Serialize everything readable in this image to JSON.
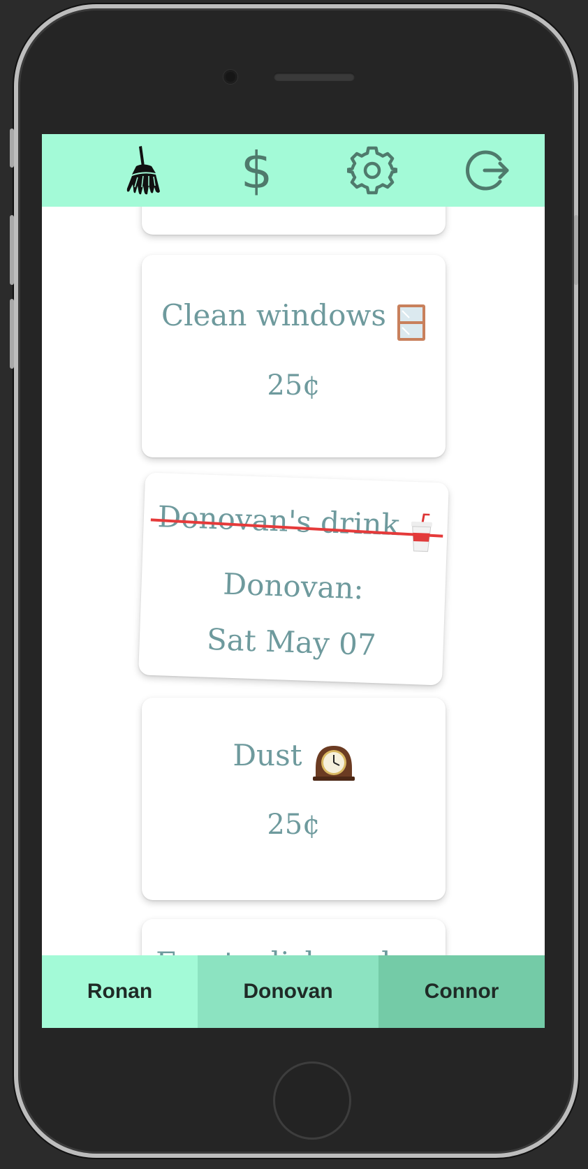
{
  "colors": {
    "accent": "#a3fad7",
    "tab_mid": "#8ce3c1",
    "tab_dark": "#74cba7",
    "card_text": "#6e9a9d",
    "strike": "#e53a3a",
    "icon": "#4f7a6c"
  },
  "nav": {
    "icons": [
      "broom-icon",
      "dollar-icon",
      "gear-icon",
      "logout-icon"
    ],
    "dollar_glyph": "$"
  },
  "chores": [
    {
      "title": "Clean windows",
      "emoji": "window-icon",
      "price": "25¢",
      "done": false
    },
    {
      "title": "Donovan's drink",
      "emoji": "drink-cup-icon",
      "done": true,
      "done_by": "Donovan:",
      "done_date": "Sat May 07"
    },
    {
      "title": "Dust",
      "emoji": "mantel-clock-icon",
      "price": "25¢",
      "done": false
    },
    {
      "title": "Empty dishwasher",
      "done": false
    }
  ],
  "tabs": [
    {
      "label": "Ronan",
      "active": true
    },
    {
      "label": "Donovan",
      "active": false
    },
    {
      "label": "Connor",
      "active": false
    }
  ]
}
